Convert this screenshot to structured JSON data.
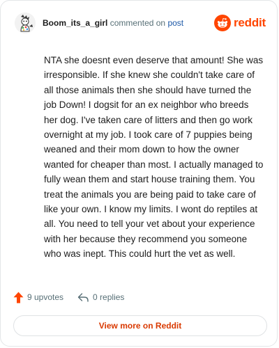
{
  "header": {
    "username": "Boom_its_a_girl",
    "action_text": "commented on",
    "post_link": "post",
    "logo_text": "reddit"
  },
  "comment": {
    "body": "NTA she doesnt even deserve that amount! She was irresponsible. If she knew she couldn't take care of all those animals then she should have turned the job Down! I dogsit for an ex neighbor who breeds her dog. I've taken care of litters and then go work overnight at my job. I took care of 7 puppies being weaned and their mom down to how the owner wanted for cheaper than most. I actually managed to fully wean them and start house training them. You treat the animals you are being paid to take care of like your own. I know my limits. I wont do reptiles at all. You need to tell your vet about your experience with her because they recommend you someone who was inept. This could hurt the vet as well."
  },
  "actions": {
    "upvotes_label": "9 upvotes",
    "replies_label": "0 replies"
  },
  "footer": {
    "view_more_label": "View more on Reddit"
  },
  "colors": {
    "brand": "#ff4500",
    "link": "#1b57a6",
    "view_more": "#d93900"
  }
}
